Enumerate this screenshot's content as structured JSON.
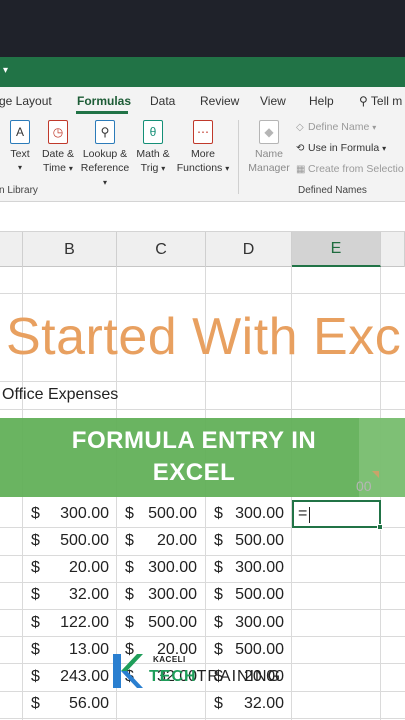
{
  "ribbon": {
    "tabs": [
      "ge Layout",
      "Formulas",
      "Data",
      "Review",
      "View",
      "Help",
      "Tell m"
    ],
    "active_tab": "Formulas",
    "buttons": {
      "text": "Text",
      "date_time_1": "Date &",
      "date_time_2": "Time",
      "lookup_1": "Lookup &",
      "lookup_2": "Reference",
      "math_1": "Math &",
      "math_2": "Trig",
      "more_1": "More",
      "more_2": "Functions",
      "name_manager_1": "Name",
      "name_manager_2": "Manager",
      "define_name": "Define Name",
      "use_in_formula": "Use in Formula",
      "create_from_selection": "Create from Selectio"
    },
    "groups": {
      "function_library": "n Library",
      "defined_names": "Defined Names"
    }
  },
  "columns": [
    "B",
    "C",
    "D",
    "E"
  ],
  "selected_column": "E",
  "sheet": {
    "title_text": "Started With Exc",
    "subtitle_text": "Office Expenses",
    "ghost_text": "00",
    "active_cell_text": "=",
    "currency_symbol": "$",
    "rows": [
      [
        "300.00",
        "500.00",
        "300.00"
      ],
      [
        "500.00",
        "20.00",
        "500.00"
      ],
      [
        "20.00",
        "300.00",
        "300.00"
      ],
      [
        "32.00",
        "300.00",
        "500.00"
      ],
      [
        "122.00",
        "500.00",
        "300.00"
      ],
      [
        "13.00",
        "20.00",
        "500.00"
      ],
      [
        "243.00",
        "32.00",
        "20.00"
      ],
      [
        "56.00",
        "",
        "32.00"
      ]
    ]
  },
  "banner": {
    "line1": "FORMULA ENTRY IN",
    "line2": "EXCEL"
  },
  "logo": {
    "small": "KACELI",
    "tech": "TECH",
    "training": "TRAINING"
  },
  "colors": {
    "excel_green": "#217346",
    "banner_green": "#62b059",
    "title_orange": "#e8a060"
  }
}
